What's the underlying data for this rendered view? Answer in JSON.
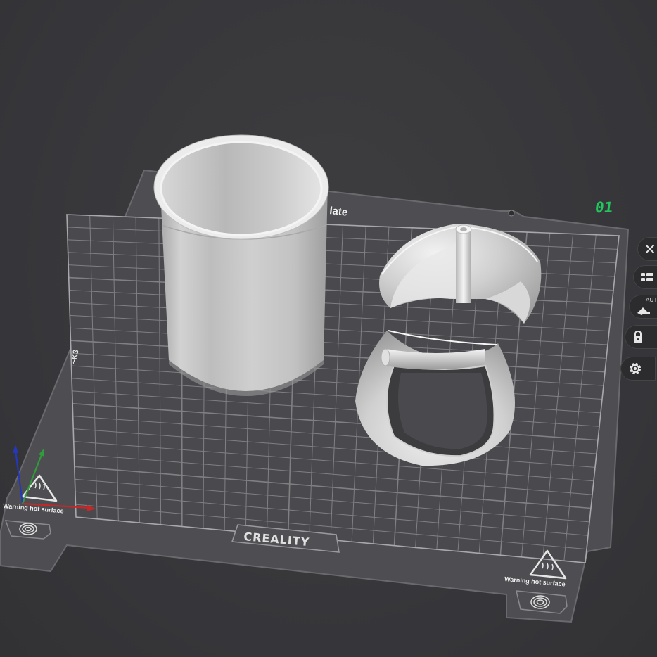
{
  "plate": {
    "name_partial": "late",
    "number": "01",
    "brand": "CREALITY",
    "warning_left": "Warning hot surface",
    "warning_right": "Warning hot surface"
  },
  "toolbar": {
    "items": [
      {
        "name": "close-icon"
      },
      {
        "name": "arrange-icon"
      },
      {
        "name": "auto-orient-icon",
        "label": "AUTO"
      },
      {
        "name": "lock-icon"
      },
      {
        "name": "settings-icon"
      }
    ]
  },
  "axes": {
    "x_color": "#c62828",
    "y_color": "#2e9d3a",
    "z_color": "#2438b8"
  },
  "colors": {
    "background": "#363638",
    "plate": "#4e4e52",
    "grid": "#8a8a8e",
    "model": "#d9d9d9",
    "accent": "#22c55e"
  }
}
